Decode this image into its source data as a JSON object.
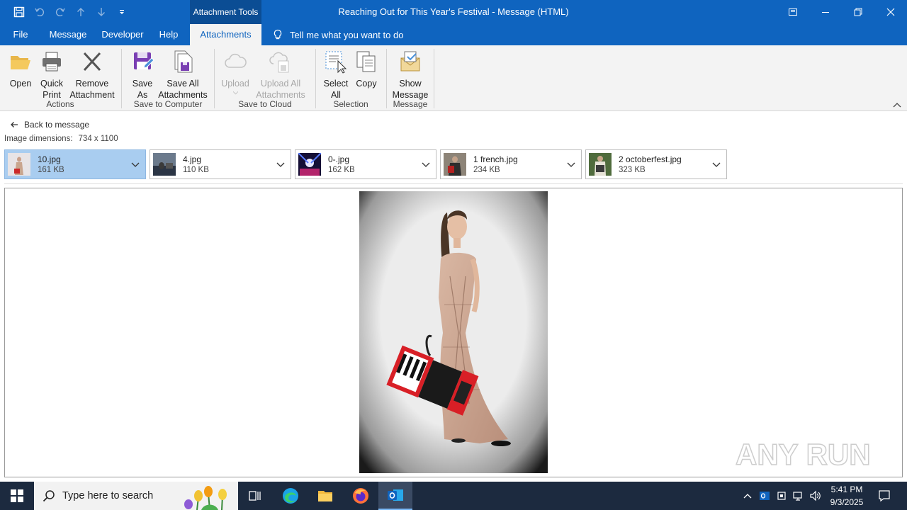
{
  "window": {
    "title": "Reaching Out for This Year's Festival  -  Message (HTML)",
    "context_tools": "Attachment Tools"
  },
  "tabs": [
    {
      "label": "File"
    },
    {
      "label": "Message"
    },
    {
      "label": "Developer"
    },
    {
      "label": "Help"
    },
    {
      "label": "Attachments",
      "active": true
    }
  ],
  "tellme": "Tell me what you want to do",
  "ribbon": {
    "buttons": {
      "open": "Open",
      "quick_print_1": "Quick",
      "quick_print_2": "Print",
      "remove_1": "Remove",
      "remove_2": "Attachment",
      "save_as_1": "Save",
      "save_as_2": "As",
      "save_all_1": "Save All",
      "save_all_2": "Attachments",
      "upload": "Upload",
      "upload_all_1": "Upload All",
      "upload_all_2": "Attachments",
      "select_all_1": "Select",
      "select_all_2": "All",
      "copy": "Copy",
      "show_msg_1": "Show",
      "show_msg_2": "Message"
    },
    "groups": {
      "actions": "Actions",
      "save_computer": "Save to Computer",
      "save_cloud": "Save to Cloud",
      "selection": "Selection",
      "message": "Message"
    }
  },
  "attachments_view": {
    "back_label": "Back to message",
    "dims_label": "Image dimensions:",
    "dims_value": "734 x 1100",
    "files": [
      {
        "name": "10.jpg",
        "size": "161 KB",
        "selected": true
      },
      {
        "name": "4.jpg",
        "size": "110 KB"
      },
      {
        "name": "0-.jpg",
        "size": "162 KB"
      },
      {
        "name": "1 french.jpg",
        "size": "234 KB"
      },
      {
        "name": "2 octoberfest.jpg",
        "size": "323 KB"
      }
    ]
  },
  "watermark": "ANY RUN",
  "taskbar": {
    "search_placeholder": "Type here to search",
    "time": "5:41 PM",
    "date": "9/3/2025"
  },
  "colors": {
    "accent": "#0f64bf",
    "selected_attachment": "#a9cdf0",
    "taskbar": "#1c2a3f"
  }
}
